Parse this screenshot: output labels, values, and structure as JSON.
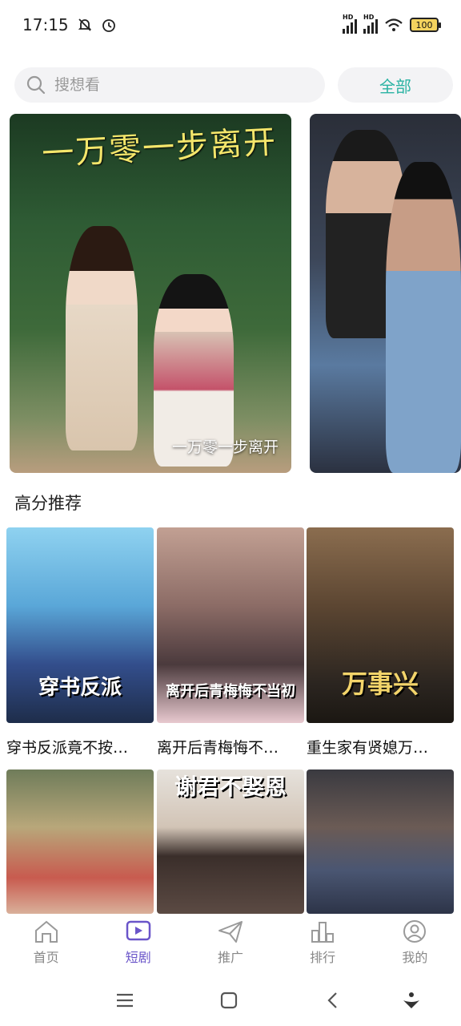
{
  "status": {
    "time": "17:15",
    "battery": "100"
  },
  "search": {
    "placeholder": "搜想看"
  },
  "filter": {
    "all_label": "全部"
  },
  "banners": [
    {
      "caption": "一万零一步离开",
      "art_title": "一万零一步离开"
    },
    {
      "caption": ""
    }
  ],
  "section": {
    "title": "高分推荐"
  },
  "dramas": [
    {
      "title": "穿书反派竟不按…",
      "poster_text": "穿书反派"
    },
    {
      "title": "离开后青梅悔不…",
      "poster_text": "离开后青梅悔不当初"
    },
    {
      "title": "重生家有贤媳万…",
      "poster_text": "万事兴"
    },
    {
      "title": "",
      "poster_text": ""
    },
    {
      "title": "",
      "poster_text": "谢君不娶恩"
    },
    {
      "title": "",
      "poster_text": ""
    }
  ],
  "nav": {
    "items": [
      {
        "label": "首页",
        "icon": "home-icon"
      },
      {
        "label": "短剧",
        "icon": "play-icon",
        "active": true
      },
      {
        "label": "推广",
        "icon": "send-icon"
      },
      {
        "label": "排行",
        "icon": "ranking-icon"
      },
      {
        "label": "我的",
        "icon": "profile-icon"
      }
    ]
  },
  "colors": {
    "accent": "#6a55c9",
    "teal": "#2bb3a3"
  }
}
